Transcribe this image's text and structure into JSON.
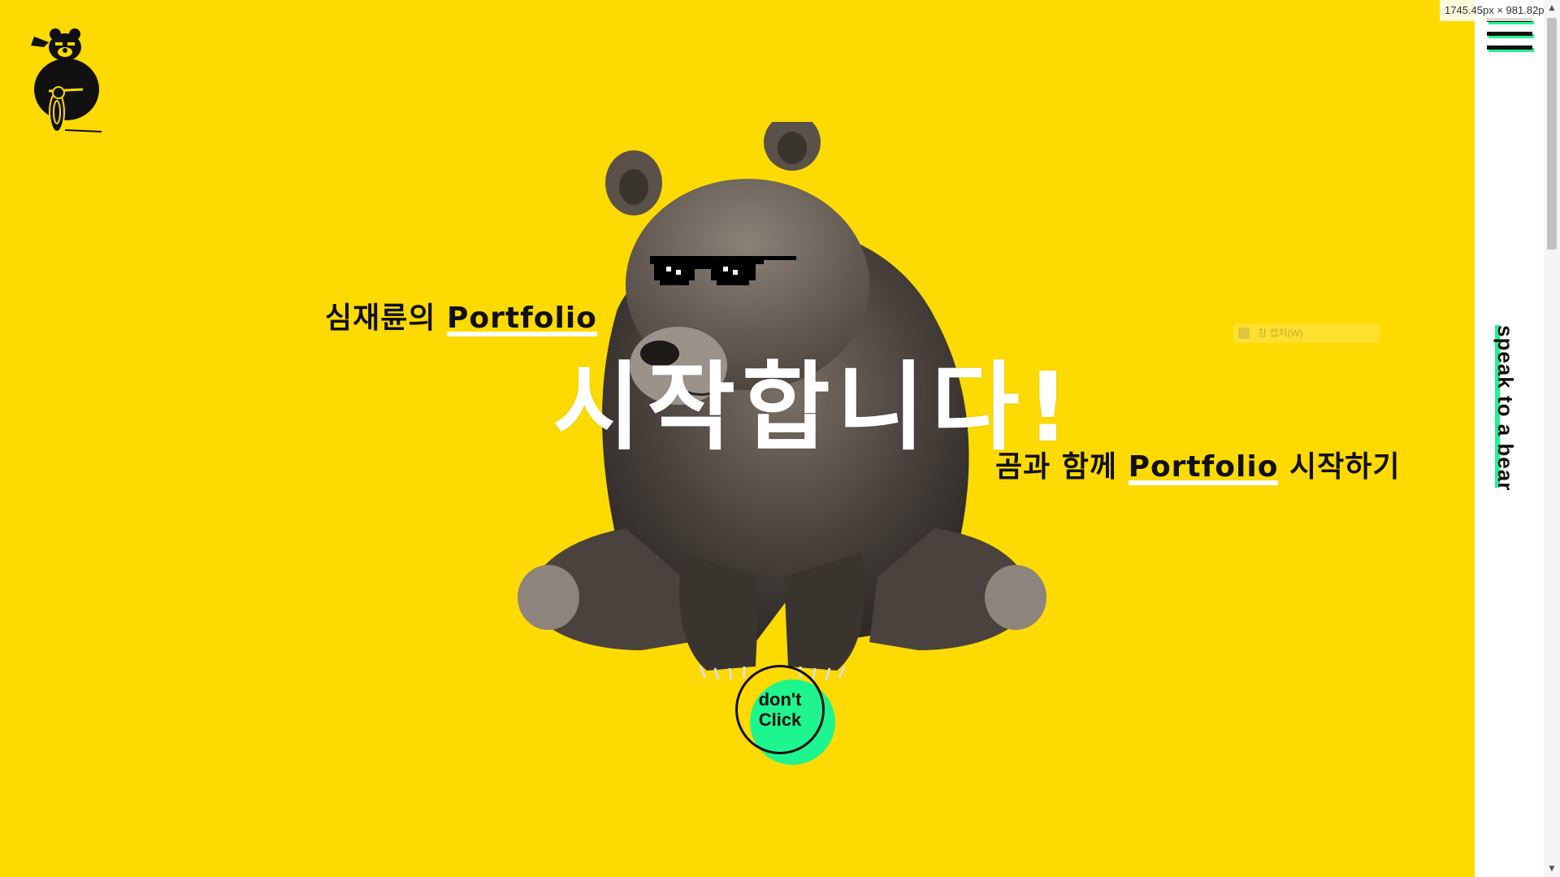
{
  "page": {
    "sub_heading_1_prefix": "심재륜의",
    "sub_heading_1_highlight": "Portfolio",
    "main_heading": "시작합니다!",
    "sub_heading_2_prefix": "곰과 함께",
    "sub_heading_2_highlight": "Portfolio",
    "sub_heading_2_suffix": "시작하기",
    "button_label": "don't Click"
  },
  "side": {
    "speak_link": "speak to a bear",
    "menu_icon": "hamburger-icon"
  },
  "overlay": {
    "dimension_badge": "1745.45px × 981.82px",
    "ghost_tooltip": "창 캡처(W)"
  },
  "colors": {
    "background": "#FFDA00",
    "accent_green": "#1FF58E",
    "text_dark": "#111111",
    "highlight_white": "#FFFFFF"
  }
}
